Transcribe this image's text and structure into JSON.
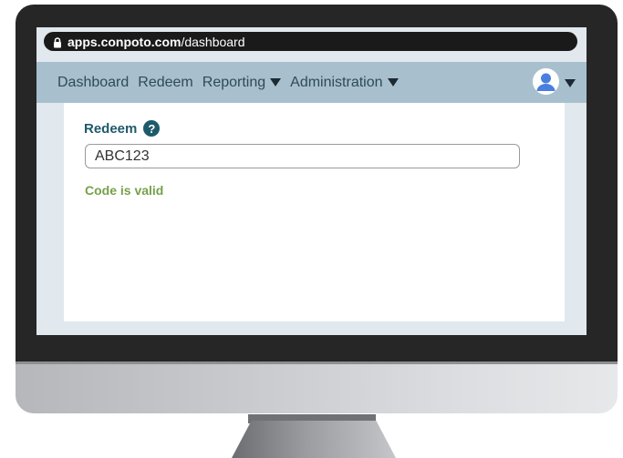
{
  "browser": {
    "url_domain": "apps.conpoto.com",
    "url_path": "/dashboard"
  },
  "nav": {
    "items": [
      {
        "label": "Dashboard",
        "has_dropdown": false
      },
      {
        "label": "Redeem",
        "has_dropdown": false
      },
      {
        "label": "Reporting",
        "has_dropdown": true
      },
      {
        "label": "Administration",
        "has_dropdown": true
      }
    ],
    "user_menu_icon": "user-avatar-icon"
  },
  "redeem": {
    "heading": "Redeem",
    "help_glyph": "?",
    "code_value": "ABC123",
    "status_message": "Code is valid"
  },
  "colors": {
    "navbar": "#a8c0cd",
    "heading": "#1f5a6b",
    "success": "#76a14a",
    "avatar": "#4a7fe0"
  },
  "icons": {
    "lock": "lock-icon",
    "help": "help-icon",
    "caret": "caret-down-icon",
    "avatar": "user-avatar-icon"
  }
}
